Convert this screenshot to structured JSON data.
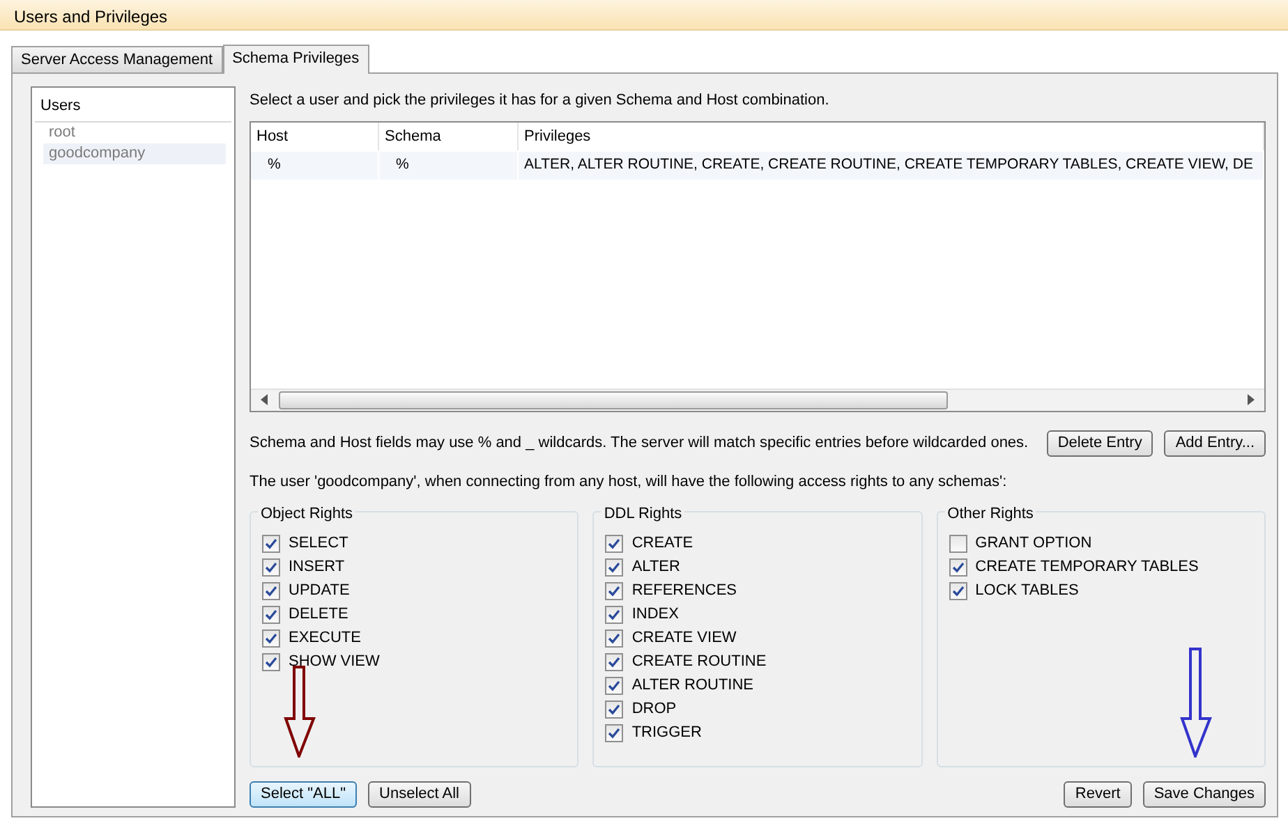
{
  "window": {
    "title": "Users and Privileges"
  },
  "tabs": [
    {
      "label": "Server Access Management",
      "selected": false
    },
    {
      "label": "Schema Privileges",
      "selected": true
    }
  ],
  "users": {
    "heading": "Users",
    "items": [
      {
        "name": "root",
        "selected": false
      },
      {
        "name": "goodcompany",
        "selected": true
      }
    ]
  },
  "intro": "Select a user and pick the privileges it has for a given Schema and Host combination.",
  "table": {
    "columns": [
      "Host",
      "Schema",
      "Privileges"
    ],
    "rows": [
      [
        "%",
        "%",
        "ALTER, ALTER ROUTINE, CREATE, CREATE ROUTINE, CREATE TEMPORARY TABLES, CREATE VIEW, DE"
      ]
    ]
  },
  "hint": "Schema and Host fields may use % and _ wildcards. The server will match specific entries before wildcarded ones.",
  "entry_buttons": [
    "Delete Entry",
    "Add Entry..."
  ],
  "summary": "The user 'goodcompany', when connecting from any host, will have the following access rights to any schemas':",
  "groups": [
    {
      "title": "Object Rights",
      "rights": [
        {
          "label": "SELECT",
          "checked": true
        },
        {
          "label": "INSERT",
          "checked": true
        },
        {
          "label": "UPDATE",
          "checked": true
        },
        {
          "label": "DELETE",
          "checked": true
        },
        {
          "label": "EXECUTE",
          "checked": true
        },
        {
          "label": "SHOW VIEW",
          "checked": true
        }
      ]
    },
    {
      "title": "DDL Rights",
      "rights": [
        {
          "label": "CREATE",
          "checked": true
        },
        {
          "label": "ALTER",
          "checked": true
        },
        {
          "label": "REFERENCES",
          "checked": true
        },
        {
          "label": "INDEX",
          "checked": true
        },
        {
          "label": "CREATE VIEW",
          "checked": true
        },
        {
          "label": "CREATE ROUTINE",
          "checked": true
        },
        {
          "label": "ALTER ROUTINE",
          "checked": true
        },
        {
          "label": "DROP",
          "checked": true
        },
        {
          "label": "TRIGGER",
          "checked": true
        }
      ]
    },
    {
      "title": "Other Rights",
      "rights": [
        {
          "label": "GRANT OPTION",
          "checked": false
        },
        {
          "label": "CREATE TEMPORARY TABLES",
          "checked": true
        },
        {
          "label": "LOCK TABLES",
          "checked": true
        }
      ]
    }
  ],
  "bottom_left_buttons": [
    {
      "label": "Select \"ALL\"",
      "focused": true
    },
    {
      "label": "Unselect All",
      "focused": false
    }
  ],
  "bottom_right_buttons": [
    "Revert",
    "Save Changes"
  ],
  "annotations": [
    {
      "kind": "arrow",
      "color": "#800000"
    },
    {
      "kind": "arrow",
      "color": "#3333cc"
    }
  ]
}
